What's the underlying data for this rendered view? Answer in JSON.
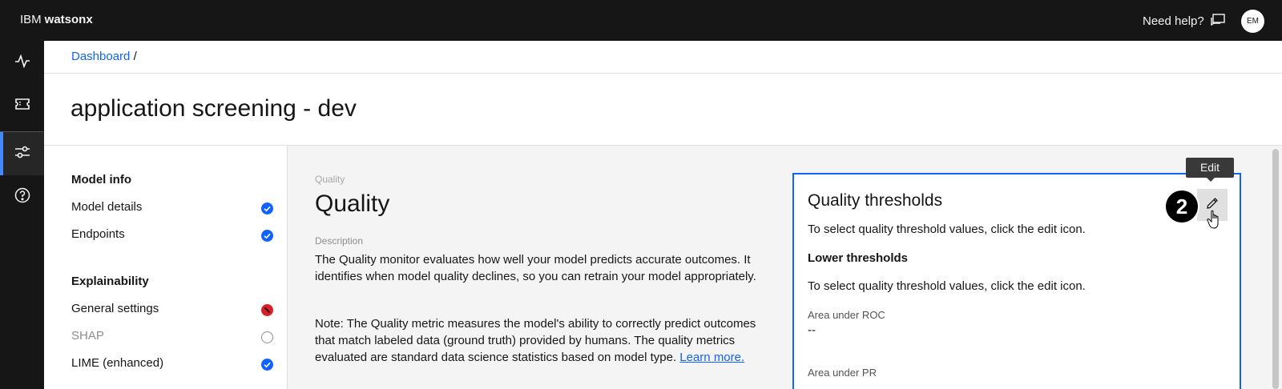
{
  "header": {
    "brand_prefix": "IBM",
    "brand_name": "watsonx",
    "help_label": "Need help?",
    "avatar_initials": "EM"
  },
  "rail": {
    "items": [
      {
        "icon": "activity-icon"
      },
      {
        "icon": "ticket-icon"
      },
      {
        "icon": "settings-adjust-icon",
        "active": true
      },
      {
        "icon": "help-icon"
      }
    ]
  },
  "breadcrumb": {
    "link": "Dashboard",
    "separator": "/"
  },
  "page": {
    "title": "application screening - dev"
  },
  "leftnav": {
    "model_info_heading": "Model info",
    "model_details": "Model details",
    "endpoints": "Endpoints",
    "explainability_heading": "Explainability",
    "general_settings": "General settings",
    "shap": "SHAP",
    "lime": "LIME (enhanced)"
  },
  "main": {
    "overline": "Quality",
    "title": "Quality",
    "description_label": "Description",
    "description": "The Quality monitor evaluates how well your model predicts accurate outcomes. It identifies when model quality declines, so you can retrain your model appropriately.",
    "note": "Note: The Quality metric measures the model's ability to correctly predict outcomes that match labeled data (ground truth) provided by humans. The quality metrics evaluated are standard data science statistics based on model type.",
    "learn_more": "Learn more."
  },
  "card": {
    "title": "Quality thresholds",
    "instruction1": "To select quality threshold values, click the edit icon.",
    "lower_heading": "Lower thresholds",
    "instruction2": "To select quality threshold values, click the edit icon.",
    "metric1_label": "Area under ROC",
    "metric1_value": "--",
    "metric2_label": "Area under PR",
    "edit_tooltip": "Edit",
    "step_number": "2"
  },
  "colors": {
    "accent": "#0f62fe",
    "error": "#da1e28",
    "topbar": "#161616"
  }
}
